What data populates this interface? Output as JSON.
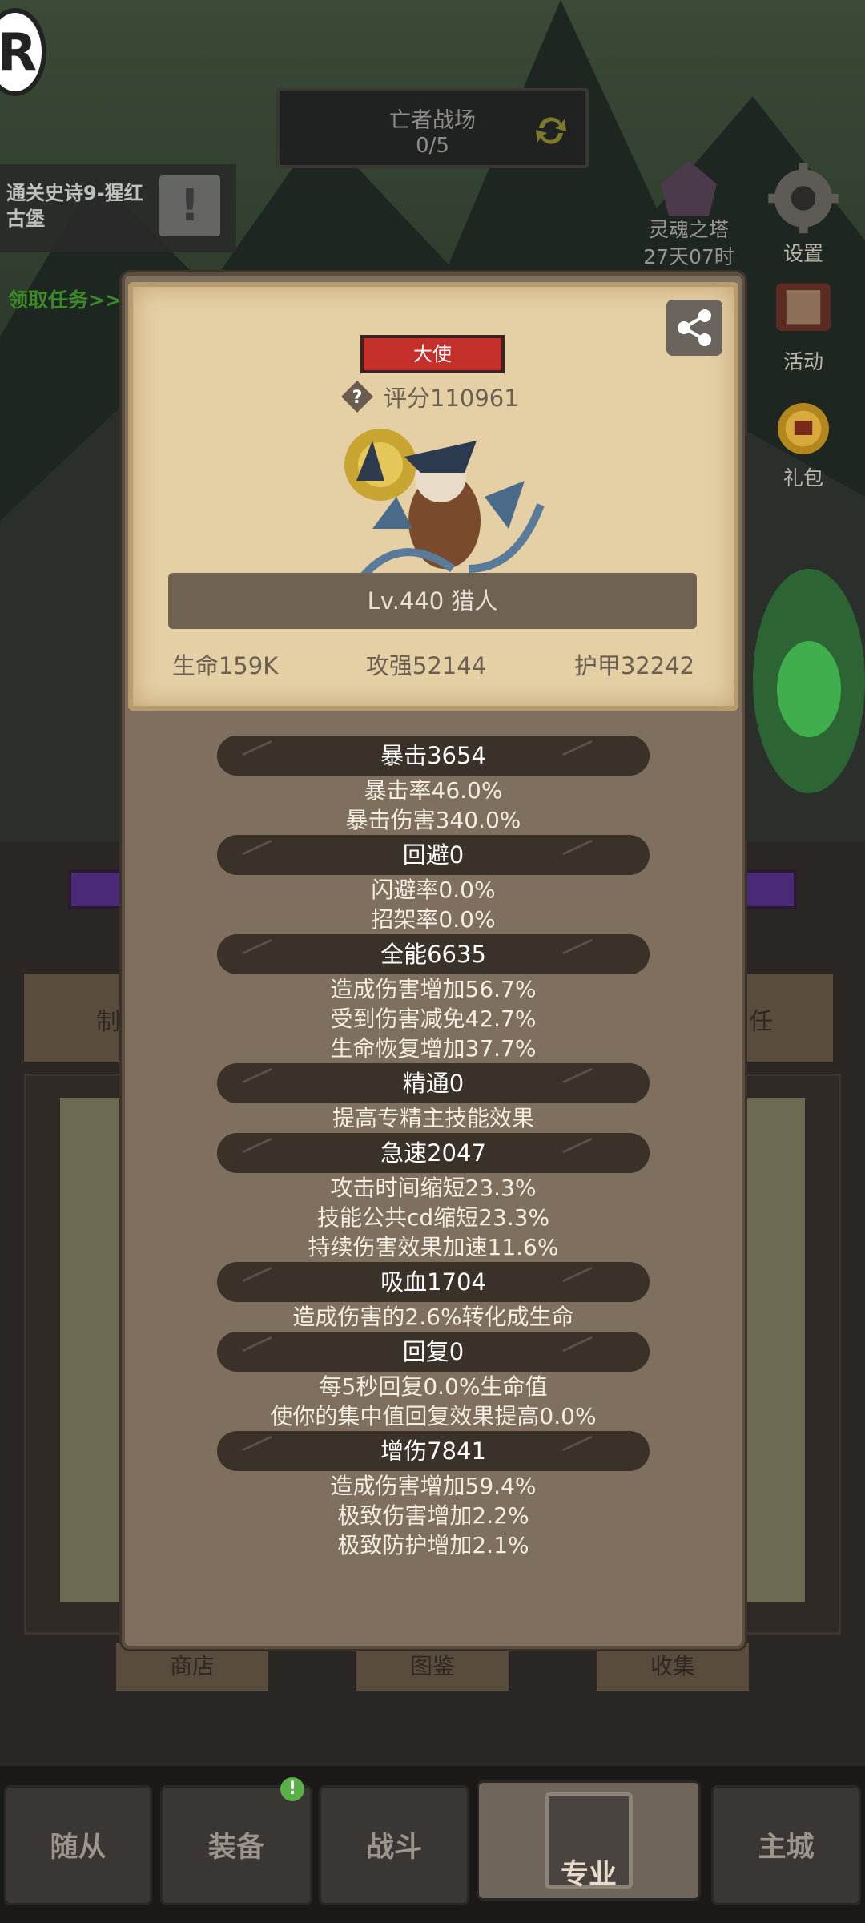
{
  "hud": {
    "logo_letter": "R",
    "battlefield": {
      "title": "亡者战场",
      "progress": "0/5"
    },
    "quest": {
      "text": "通关史诗9-猩红古堡",
      "alert_icon": "exclamation-icon"
    },
    "claim_task": "领取任务>>",
    "soul_tower": {
      "name": "灵魂之塔",
      "timer": "27天07时"
    },
    "side_buttons": [
      {
        "label": "设置",
        "icon": "gear-icon"
      },
      {
        "label": "活动",
        "icon": "scroll-icon"
      },
      {
        "label": "礼包",
        "icon": "gift-icon"
      }
    ]
  },
  "background": {
    "tab_left": "制",
    "tab_right": "任",
    "sub_buttons": [
      "商店",
      "图鉴",
      "收集"
    ]
  },
  "modal": {
    "rank": "大使",
    "score_label": "评分110961",
    "level_class": "Lv.440 猎人",
    "top_stats": [
      "生命159K",
      "攻强52144",
      "护甲32242"
    ],
    "groups": [
      {
        "title": "暴击3654",
        "lines": [
          "暴击率46.0%",
          "暴击伤害340.0%"
        ]
      },
      {
        "title": "回避0",
        "lines": [
          "闪避率0.0%",
          "招架率0.0%"
        ]
      },
      {
        "title": "全能6635",
        "lines": [
          "造成伤害增加56.7%",
          "受到伤害减免42.7%",
          "生命恢复增加37.7%"
        ]
      },
      {
        "title": "精通0",
        "lines": [
          "提高专精主技能效果"
        ]
      },
      {
        "title": "急速2047",
        "lines": [
          "攻击时间缩短23.3%",
          "技能公共cd缩短23.3%",
          "持续伤害效果加速11.6%"
        ]
      },
      {
        "title": "吸血1704",
        "lines": [
          "造成伤害的2.6%转化成生命"
        ]
      },
      {
        "title": "回复0",
        "lines": [
          "每5秒回复0.0%生命值",
          "使你的集中值回复效果提高0.0%"
        ]
      },
      {
        "title": "增伤7841",
        "lines": [
          "造成伤害增加59.4%",
          "极致伤害增加2.2%",
          "极致防护增加2.1%"
        ]
      }
    ]
  },
  "bottom_nav": {
    "items": [
      "随从",
      "装备",
      "战斗",
      "专业",
      "主城"
    ],
    "active": "专业",
    "badge": "!"
  },
  "colors": {
    "parchment": "#e5cfa5",
    "modal_frame": "#7e6f5e",
    "rank_red": "#c6302a",
    "stat_pill": "#3a3129"
  }
}
